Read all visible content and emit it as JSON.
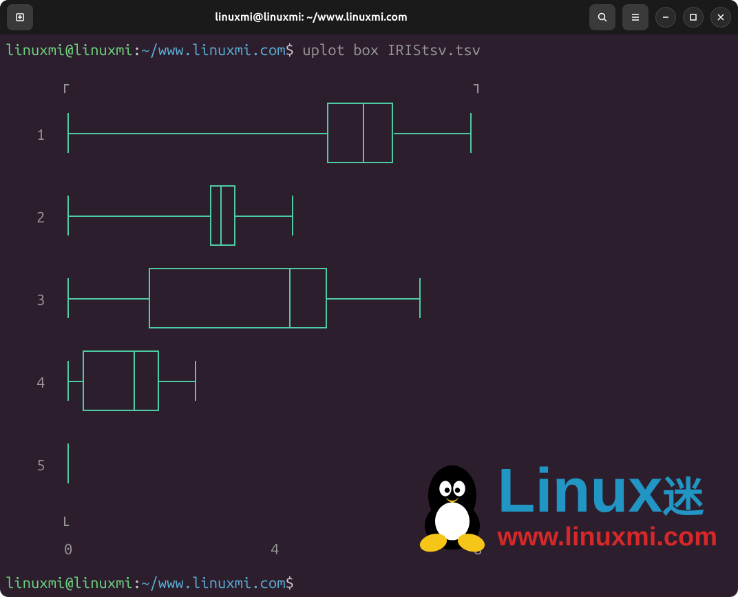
{
  "titlebar": {
    "title": "linuxmi@linuxmi: ~/www.linuxmi.com"
  },
  "prompt": {
    "user_host": "linuxmi@linuxmi",
    "separator": ":",
    "path": "~/www.linuxmi.com",
    "dollar": "$",
    "command": "uplot box IRIStsv.tsv"
  },
  "chart_data": {
    "type": "boxplot",
    "x_range": [
      0,
      10
    ],
    "x_ticks": [
      0,
      4,
      8
    ],
    "categories": [
      "1",
      "2",
      "3",
      "4",
      "5"
    ],
    "boxes": [
      {
        "label": "1",
        "min": 0,
        "q1": 5.1,
        "median": 5.8,
        "q3": 6.4,
        "max": 7.9
      },
      {
        "label": "2",
        "min": 0,
        "q1": 2.8,
        "median": 3.0,
        "q3": 3.3,
        "max": 4.4
      },
      {
        "label": "3",
        "min": 0,
        "q1": 1.6,
        "median": 4.35,
        "q3": 5.1,
        "max": 6.9
      },
      {
        "label": "4",
        "min": 0,
        "q1": 0.3,
        "median": 1.3,
        "q3": 1.8,
        "max": 2.5
      },
      {
        "label": "5",
        "min": 0,
        "q1": 0,
        "median": 0,
        "q3": 0,
        "max": 0
      }
    ],
    "axis_markers": {
      "top_left": "┌",
      "top_right": "┐",
      "bot_left": "└"
    }
  },
  "watermark": {
    "brand": "Linux",
    "suffix": "迷",
    "url": "www.linuxmi.com"
  }
}
